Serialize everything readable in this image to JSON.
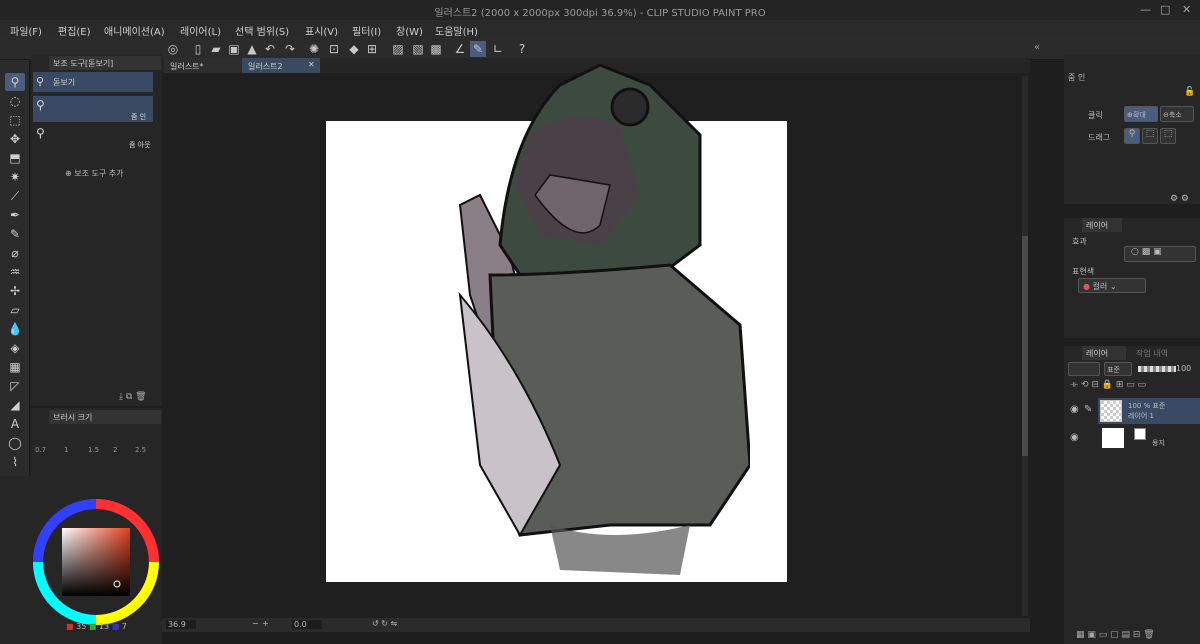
{
  "window": {
    "title": "일러스트2 (2000 x 2000px 300dpi 36.9%)  - CLIP STUDIO PAINT PRO",
    "min": "—",
    "max": "□",
    "close": "✕"
  },
  "menu": [
    "파일(F)",
    "편집(E)",
    "애니메이션(A)",
    "레이어(L)",
    "선택 범위(S)",
    "표시(V)",
    "필터(I)",
    "창(W)",
    "도움말(H)"
  ],
  "subtool": {
    "tab": "보조 도구[돋보기]",
    "items": [
      {
        "label": "돋보기"
      },
      {
        "label": "줌 인"
      },
      {
        "label": "줌 아웃"
      }
    ],
    "add_label": "보조 도구 추가"
  },
  "brush": {
    "tab": "브러시 크기",
    "sizes": [
      "0.7",
      "1",
      "1.5",
      "2",
      "2.5"
    ]
  },
  "color": {
    "r": "35",
    "g": "13",
    "b": "7",
    "main": "#7aa0c8",
    "sub": "#1c1c1c"
  },
  "doc_tabs": [
    {
      "label": "일러스트*"
    },
    {
      "label": "일러스트2"
    }
  ],
  "status": {
    "zoom": "36.9",
    "angle": "0.0"
  },
  "tool_property": {
    "title": "줌 인",
    "click_label": "클릭",
    "drag_label": "드래그",
    "zoom_in": "확대",
    "zoom_out": "축소"
  },
  "effect": {
    "tab": "레이어",
    "effect_label": "효과",
    "expression_label": "표현색",
    "expression_value": "컬러"
  },
  "layers": {
    "tab": "레이어",
    "tab2": "작업 내역",
    "blend": "표준",
    "opacity": "100",
    "items": [
      {
        "line1": "100 % 표준",
        "line2": "레이어 1"
      },
      {
        "line1": "",
        "line2": "용지"
      }
    ]
  }
}
